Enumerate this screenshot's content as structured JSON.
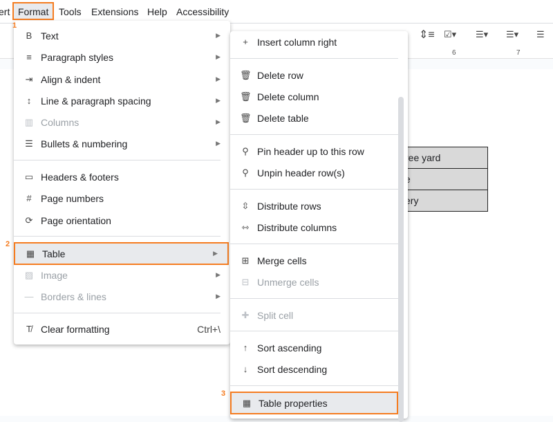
{
  "menubar": [
    "ert",
    "Format",
    "Tools",
    "Extensions",
    "Help",
    "Accessibility"
  ],
  "ruler": [
    "6",
    "7"
  ],
  "table_cells": [
    "ree yard",
    "e",
    "ery"
  ],
  "step_labels": [
    "1",
    "2",
    "3"
  ],
  "format_menu": [
    {
      "label": "Text",
      "icon": "bold-icon",
      "arrow": true
    },
    {
      "label": "Paragraph styles",
      "icon": "paragraph-icon",
      "arrow": true
    },
    {
      "label": "Align & indent",
      "icon": "indent-icon",
      "arrow": true
    },
    {
      "label": "Line & paragraph spacing",
      "icon": "line-spacing-icon",
      "arrow": true
    },
    {
      "label": "Columns",
      "icon": "columns-icon",
      "arrow": true,
      "disabled": true
    },
    {
      "label": "Bullets & numbering",
      "icon": "list-icon",
      "arrow": true
    },
    {
      "label": "Headers & footers",
      "icon": "header-icon"
    },
    {
      "label": "Page numbers",
      "icon": "hash-icon"
    },
    {
      "label": "Page orientation",
      "icon": "rotate-icon"
    },
    {
      "label": "Table",
      "icon": "table-icon",
      "arrow": true,
      "highlighted": true
    },
    {
      "label": "Image",
      "icon": "image-icon",
      "arrow": true,
      "disabled": true
    },
    {
      "label": "Borders & lines",
      "icon": "border-icon",
      "arrow": true,
      "disabled": true
    },
    {
      "label": "Clear formatting",
      "icon": "clear-format-icon",
      "shortcut": "Ctrl+\\"
    }
  ],
  "table_menu": [
    {
      "label": "Insert column right",
      "icon": "plus-icon"
    },
    {
      "label": "Delete row",
      "icon": "trash-icon"
    },
    {
      "label": "Delete column",
      "icon": "trash-icon"
    },
    {
      "label": "Delete table",
      "icon": "trash-icon"
    },
    {
      "label": "Pin header up to this row",
      "icon": "pin-icon"
    },
    {
      "label": "Unpin header row(s)",
      "icon": "unpin-icon"
    },
    {
      "label": "Distribute rows",
      "icon": "distribute-rows-icon"
    },
    {
      "label": "Distribute columns",
      "icon": "distribute-columns-icon"
    },
    {
      "label": "Merge cells",
      "icon": "merge-icon"
    },
    {
      "label": "Unmerge cells",
      "icon": "unmerge-icon",
      "disabled": true
    },
    {
      "label": "Split cell",
      "icon": "split-icon",
      "disabled": true
    },
    {
      "label": "Sort ascending",
      "icon": "sort-asc-icon"
    },
    {
      "label": "Sort descending",
      "icon": "sort-desc-icon"
    },
    {
      "label": "Table properties",
      "icon": "table-icon",
      "highlighted": true
    }
  ],
  "colors": {
    "highlight": "#f57c20"
  }
}
